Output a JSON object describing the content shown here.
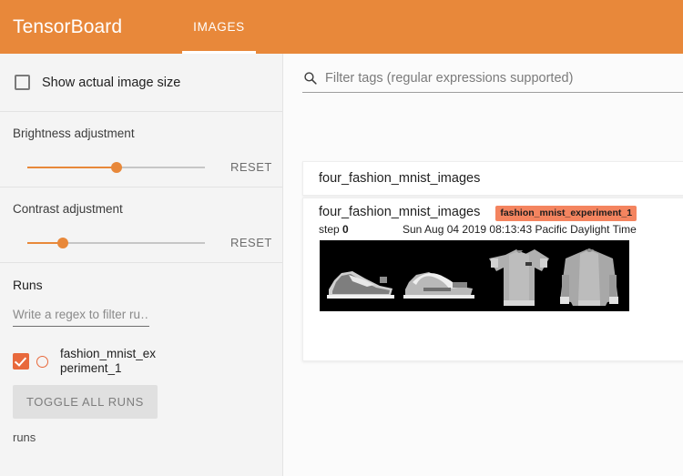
{
  "header": {
    "brand": "TensorBoard",
    "tabs": [
      {
        "label": "IMAGES",
        "active": true
      }
    ]
  },
  "sidebar": {
    "show_actual_size": {
      "label": "Show actual image size",
      "checked": false,
      "icon": "checkbox-unchecked-icon"
    },
    "brightness": {
      "title": "Brightness adjustment",
      "reset_label": "RESET",
      "value_percent": 50
    },
    "contrast": {
      "title": "Contrast adjustment",
      "reset_label": "RESET",
      "value_percent": 20
    },
    "runs": {
      "title": "Runs",
      "filter_placeholder": "Write a regex to filter ru…",
      "filter_value": "",
      "items": [
        {
          "name": "fashion_mnist_experiment_1",
          "checked": true,
          "color": "#e8693c"
        }
      ],
      "toggle_all_label": "TOGGLE ALL RUNS",
      "caption": "runs"
    }
  },
  "panel": {
    "search": {
      "placeholder": "Filter tags (regular expressions supported)",
      "value": "",
      "icon": "search-icon"
    },
    "tag_group": "four_fashion_mnist_images",
    "card": {
      "title": "four_fashion_mnist_images",
      "run_badge": "fashion_mnist_experiment_1",
      "step_label": "step",
      "step_value": "0",
      "timestamp": "Sun Aug 04 2019 08:13:43 Pacific Daylight Time",
      "image_alt": "four-fashion-mnist-grayscale-sprites"
    }
  },
  "colors": {
    "accent": "#e8883a",
    "run_accent": "#e8693c",
    "badge": "#f4845f",
    "sidebar_bg": "#f4f4f4",
    "panel_bg": "#fbfbfb"
  }
}
